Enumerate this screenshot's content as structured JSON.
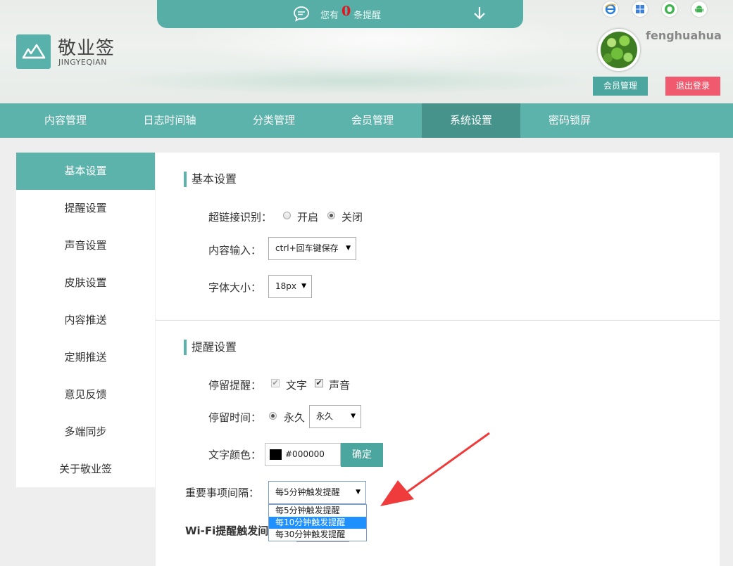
{
  "brand": {
    "title": "敬业签",
    "subtitle": "JINGYEQIAN"
  },
  "notice": {
    "prefix": "您有",
    "count": "0",
    "suffix": "条提醒"
  },
  "platforms": [
    "ie-icon",
    "windows-icon",
    "apple-icon",
    "android-icon"
  ],
  "user": {
    "name": "fenghuahua",
    "member_btn": "会员管理",
    "logout_btn": "退出登录"
  },
  "nav": [
    "内容管理",
    "日志时间轴",
    "分类管理",
    "会员管理",
    "系统设置",
    "密码锁屏"
  ],
  "nav_active_index": 4,
  "sidebar": [
    "基本设置",
    "提醒设置",
    "声音设置",
    "皮肤设置",
    "内容推送",
    "定期推送",
    "意见反馈",
    "多端同步",
    "关于敬业签"
  ],
  "basic": {
    "title": "基本设置",
    "hyperlink_label": "超链接识别：",
    "hyperlink_on": "开启",
    "hyperlink_off": "关闭",
    "input_label": "内容输入：",
    "input_value": "ctrl+回车键保存",
    "fontsize_label": "字体大小：",
    "fontsize_value": "18px"
  },
  "reminder": {
    "title": "提醒设置",
    "stay_label": "停留提醒：",
    "stay_text": "文字",
    "stay_sound": "声音",
    "time_label": "停留时间：",
    "time_radio": "永久",
    "time_select": "永久",
    "color_label": "文字颜色：",
    "color_value": "#000000",
    "confirm_btn": "确定",
    "interval_label": "重要事项间隔：",
    "interval_value": "每5分钟触发提醒",
    "interval_options": [
      "每5分钟触发提醒",
      "每10分钟触发提醒",
      "每30分钟触发提醒"
    ],
    "interval_highlight": 1,
    "wifi_label": "Wi-Fi提醒触发间"
  },
  "colors": {
    "accent": "#5cb3ab",
    "accent_dark": "#46938c",
    "logout": "#f05a6e",
    "annotation": "#ef3b3b"
  }
}
